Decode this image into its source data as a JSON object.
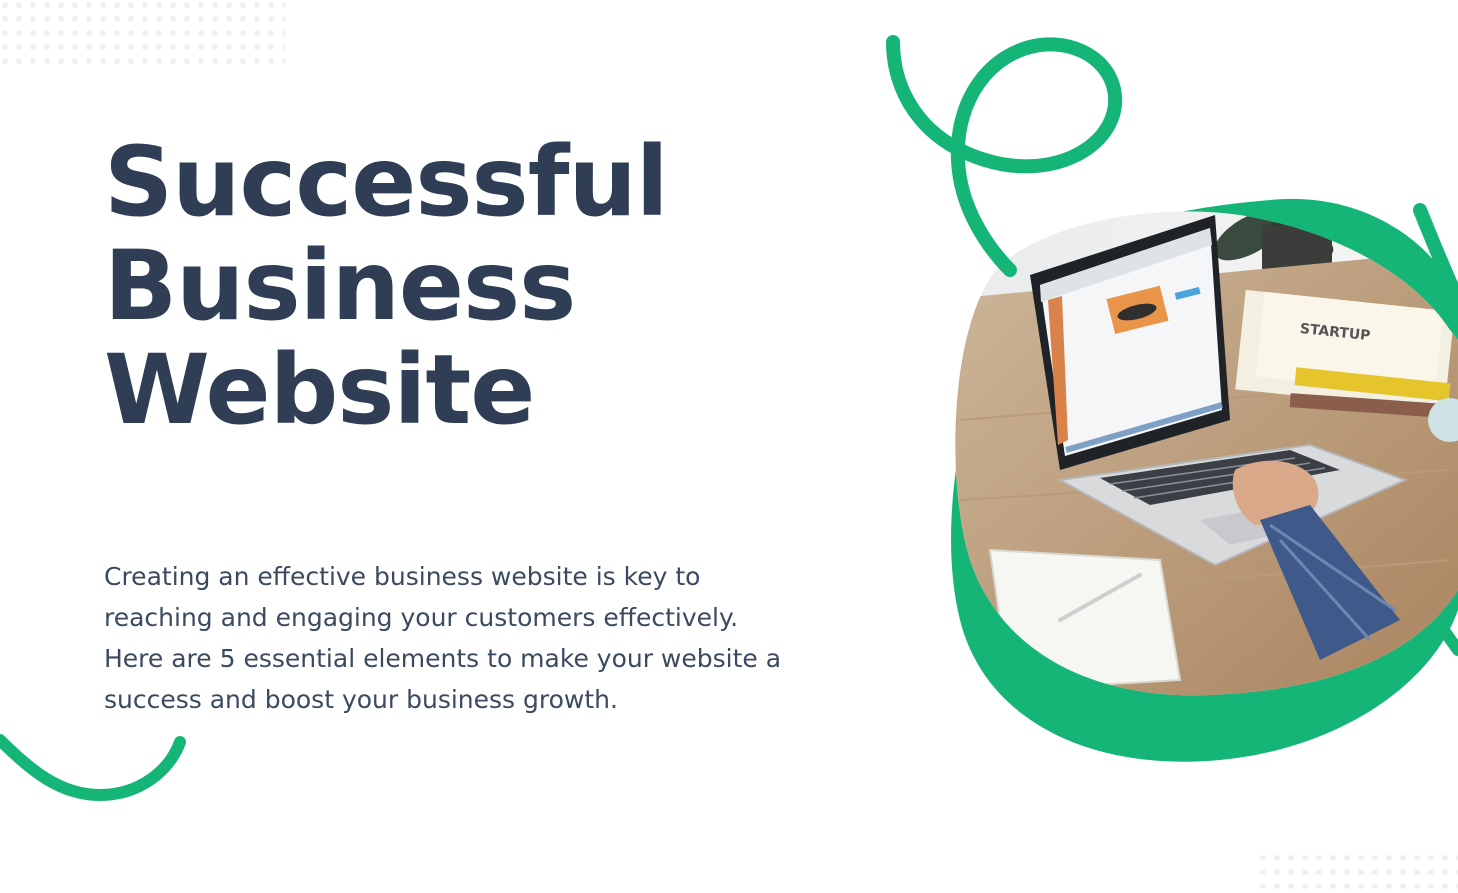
{
  "title_lines": [
    "Successful",
    "Business",
    "Website"
  ],
  "body": "Creating an effective business website is key to reaching and engaging your customers effectively. Here are 5 essential elements to make your website a success and boost your business growth.",
  "colors": {
    "title": "#2f3e55",
    "body_text": "#3b4a5f",
    "accent_green": "#14b576",
    "dot_pattern": "#eef0f3"
  },
  "image": {
    "description_icon": "laptop-photo",
    "screen_book_label": "STARTUP"
  }
}
